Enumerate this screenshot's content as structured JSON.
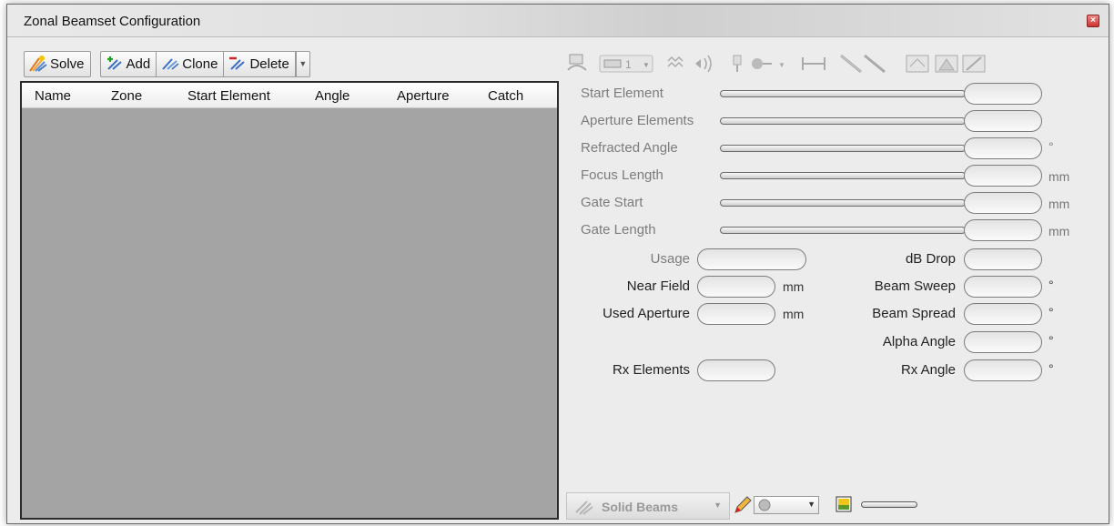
{
  "window": {
    "title": "Zonal Beamset Configuration"
  },
  "toolbar": {
    "solve_label": "Solve",
    "add_label": "Add",
    "clone_label": "Clone",
    "delete_label": "Delete"
  },
  "table": {
    "columns": [
      "Name",
      "Zone",
      "Start Element",
      "Angle",
      "Aperture",
      "Catch"
    ],
    "rows": []
  },
  "params": {
    "start_element": {
      "label": "Start Element",
      "value": "",
      "unit": ""
    },
    "aperture_elements": {
      "label": "Aperture Elements",
      "value": "",
      "unit": ""
    },
    "refracted_angle": {
      "label": "Refracted Angle",
      "value": "",
      "unit": "°"
    },
    "focus_length": {
      "label": "Focus Length",
      "value": "",
      "unit": "mm"
    },
    "gate_start": {
      "label": "Gate Start",
      "value": "",
      "unit": "mm"
    },
    "gate_length": {
      "label": "Gate Length",
      "value": "",
      "unit": "mm"
    }
  },
  "info": {
    "usage": {
      "label": "Usage",
      "value": ""
    },
    "near_field": {
      "label": "Near Field",
      "value": "",
      "unit": "mm"
    },
    "used_aperture": {
      "label": "Used Aperture",
      "value": "",
      "unit": "mm"
    },
    "rx_elements": {
      "label": "Rx Elements",
      "value": ""
    },
    "db_drop": {
      "label": "dB Drop",
      "value": ""
    },
    "beam_sweep": {
      "label": "Beam Sweep",
      "value": "",
      "unit": "°"
    },
    "beam_spread": {
      "label": "Beam Spread",
      "value": "",
      "unit": "°"
    },
    "alpha_angle": {
      "label": "Alpha Angle",
      "value": "",
      "unit": "°"
    },
    "rx_angle": {
      "label": "Rx Angle",
      "value": "",
      "unit": "°"
    }
  },
  "right_toolbar": {
    "count_label": "1"
  },
  "bottom": {
    "display_mode": "Solid Beams"
  },
  "colors": {
    "table_bg": "#a4a4a4",
    "disabled_text": "#7c7c7c",
    "close_red": "#cc3333"
  },
  "icons": [
    "solve-icon",
    "add-icon",
    "clone-icon",
    "delete-icon",
    "pencil-icon",
    "color-swatch-icon"
  ]
}
